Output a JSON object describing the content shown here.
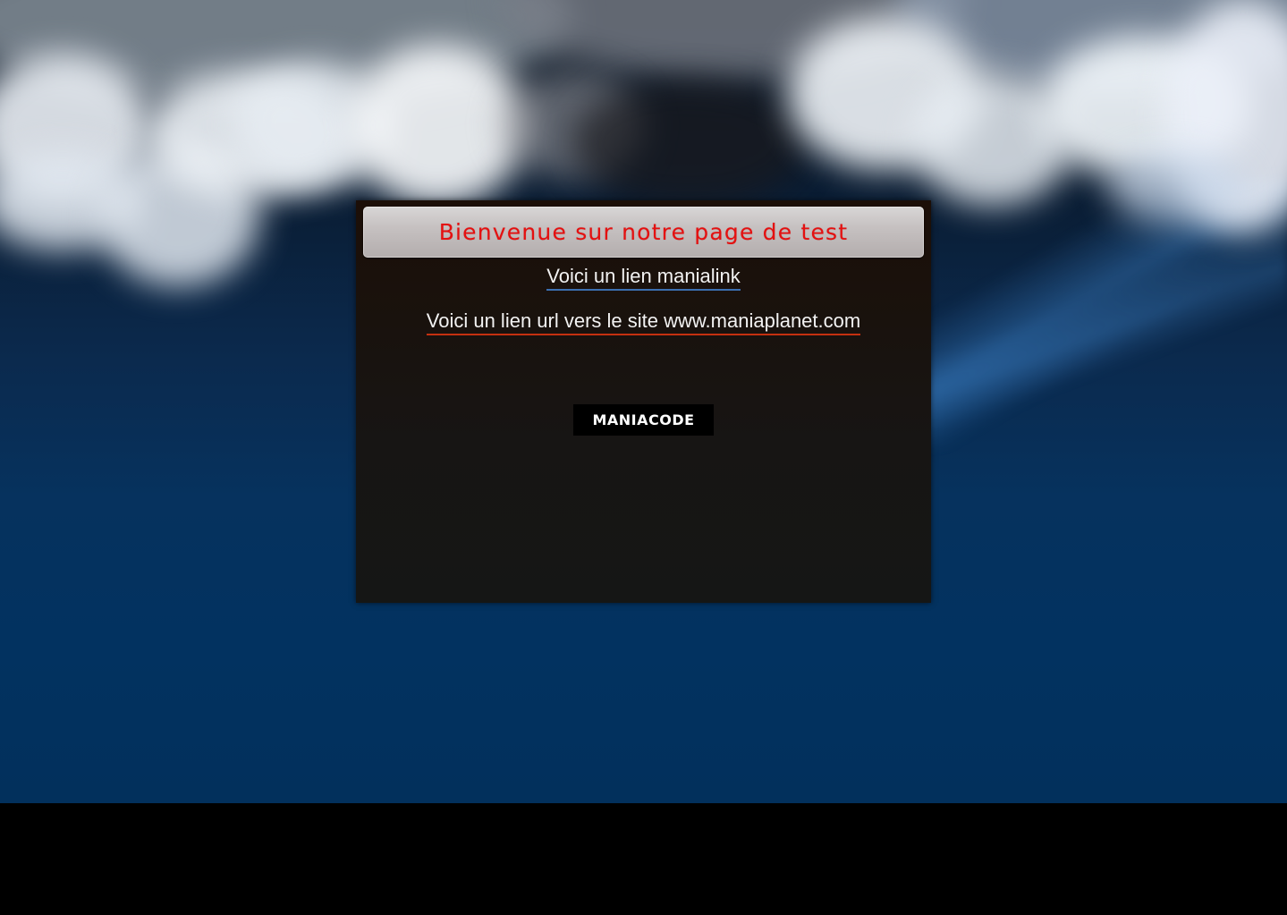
{
  "page": {
    "title": "Bienvenue sur notre page de test"
  },
  "links": {
    "manialink_label": "Voici un lien manialink",
    "url_label": "Voici un lien url vers le site www.maniaplanet.com"
  },
  "buttons": {
    "maniacode_label": "MANIACODE"
  },
  "colors": {
    "title_text": "#e51010",
    "manialink_underline": "#3b6fb0",
    "url_underline": "#c43010",
    "panel_background": "#171514",
    "sky_background": "#02305c"
  },
  "icons": {
    "background": "cloudy-sky-background"
  }
}
